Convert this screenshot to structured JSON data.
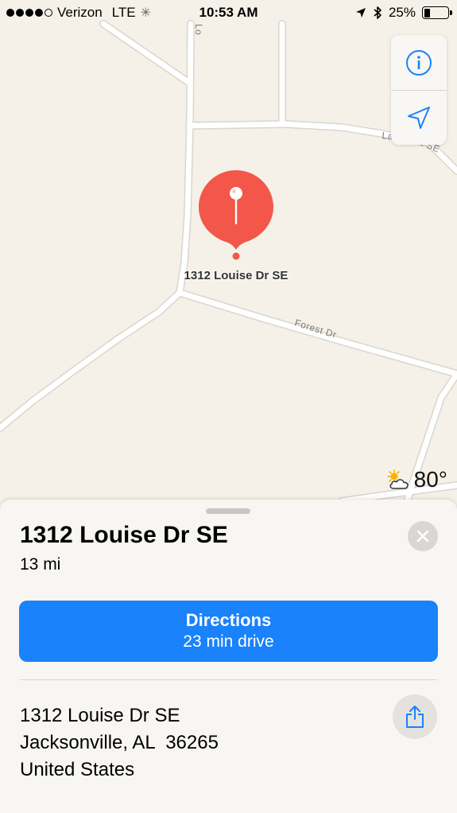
{
  "status_bar": {
    "carrier": "Verizon",
    "network": "LTE",
    "time": "10:53 AM",
    "battery_percent": "25%",
    "battery_level": 0.25,
    "signal_bars_filled": 4,
    "signal_bars_total": 5
  },
  "map": {
    "road_labels": [
      "Lo",
      "La",
      "ot SE",
      "Forest Dr"
    ],
    "controls": {
      "info_icon": "info-icon",
      "location_icon": "location-arrow-icon"
    },
    "pin": {
      "label": "1312 Louise Dr SE",
      "color": "#f2574a"
    },
    "weather": {
      "temperature": "80°",
      "icon": "partly-sunny-icon"
    }
  },
  "card": {
    "title": "1312 Louise Dr SE",
    "distance": "13 mi",
    "directions": {
      "label": "Directions",
      "subtitle": "23 min drive",
      "color": "#1a82fb"
    },
    "address_lines": [
      "1312 Louise Dr SE",
      "Jacksonville, AL  36265",
      "United States"
    ]
  }
}
